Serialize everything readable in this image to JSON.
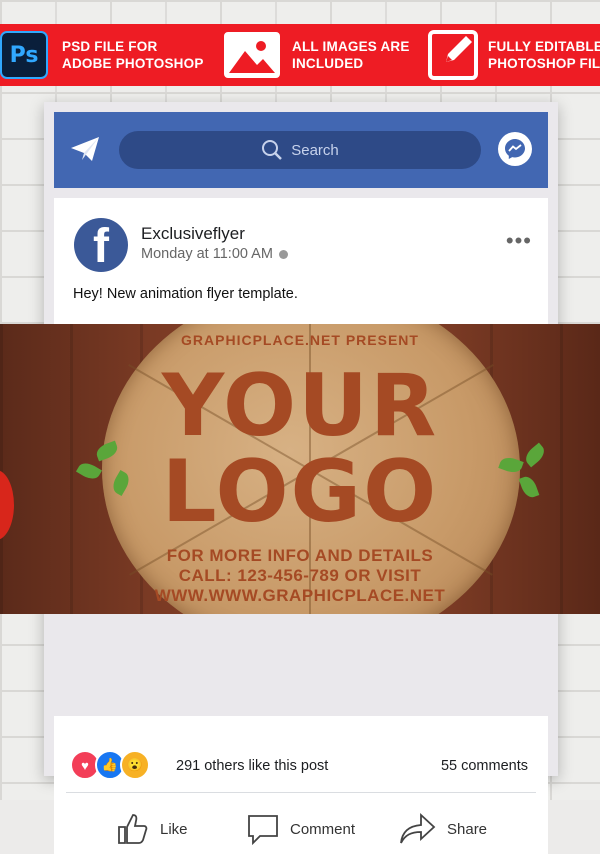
{
  "banner": {
    "features": [
      {
        "icon": "photoshop-icon",
        "line1": "PSD FILE FOR",
        "line2": "ADOBE PHOTOSHOP",
        "icon_text": "Ps"
      },
      {
        "icon": "image-icon",
        "line1": "ALL IMAGES ARE",
        "line2": "INCLUDED"
      },
      {
        "icon": "edit-icon",
        "line1": "FULLY EDITABLE",
        "line2": "PHOTOSHOP FILE"
      }
    ]
  },
  "navbar": {
    "search_placeholder": "Search",
    "left_icon": "paper-plane-icon",
    "right_icon": "messenger-icon",
    "color": "#4267b2"
  },
  "post": {
    "author": "Exclusiveflyer",
    "avatar_letter": "f",
    "time": "Monday at 11:00 AM",
    "text": "Hey! New animation flyer template.",
    "more_icon": "more-dots-icon"
  },
  "flyer": {
    "header": "GRAPHICPLACE.NET PRESENT",
    "logo_line1": "YOUR",
    "logo_line2": "LOGO",
    "info_line1": "FOR MORE INFO AND DETAILS",
    "info_line2": "CALL: 123-456-789 OR VISIT",
    "info_line3": "WWW.WWW.GRAPHICPLACE.NET"
  },
  "stats": {
    "likes_text": "291 others like this post",
    "comments_text": "55 comments",
    "reactions": [
      "love",
      "like",
      "wow"
    ]
  },
  "actions": {
    "like": "Like",
    "comment": "Comment",
    "share": "Share"
  },
  "colors": {
    "banner_red": "#ee1c24",
    "facebook_blue": "#4267b2",
    "flyer_text": "#a54a24"
  }
}
